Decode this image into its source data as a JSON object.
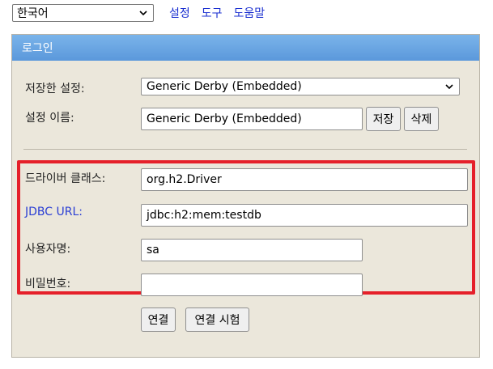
{
  "top": {
    "language": "한국어",
    "links": [
      "설정",
      "도구",
      "도움말"
    ]
  },
  "login": {
    "header": "로그인",
    "saved_settings_label": "저장한 설정:",
    "saved_settings_value": "Generic Derby (Embedded)",
    "setting_name_label": "설정 이름:",
    "setting_name_value": "Generic Derby (Embedded)",
    "save_button": "저장",
    "delete_button": "삭제",
    "driver_label": "드라이버 클래스:",
    "driver_value": "org.h2.Driver",
    "jdbc_label": "JDBC URL:",
    "jdbc_value": "jdbc:h2:mem:testdb",
    "user_label": "사용자명:",
    "user_value": "sa",
    "password_label": "비밀번호:",
    "password_value": "",
    "connect_button": "연결",
    "test_button": "연결 시험"
  },
  "colors": {
    "header_blue": "#5b98db",
    "panel_bg": "#ebe7db",
    "highlight_red": "#e5202a",
    "link_blue": "#1a2fd0"
  }
}
